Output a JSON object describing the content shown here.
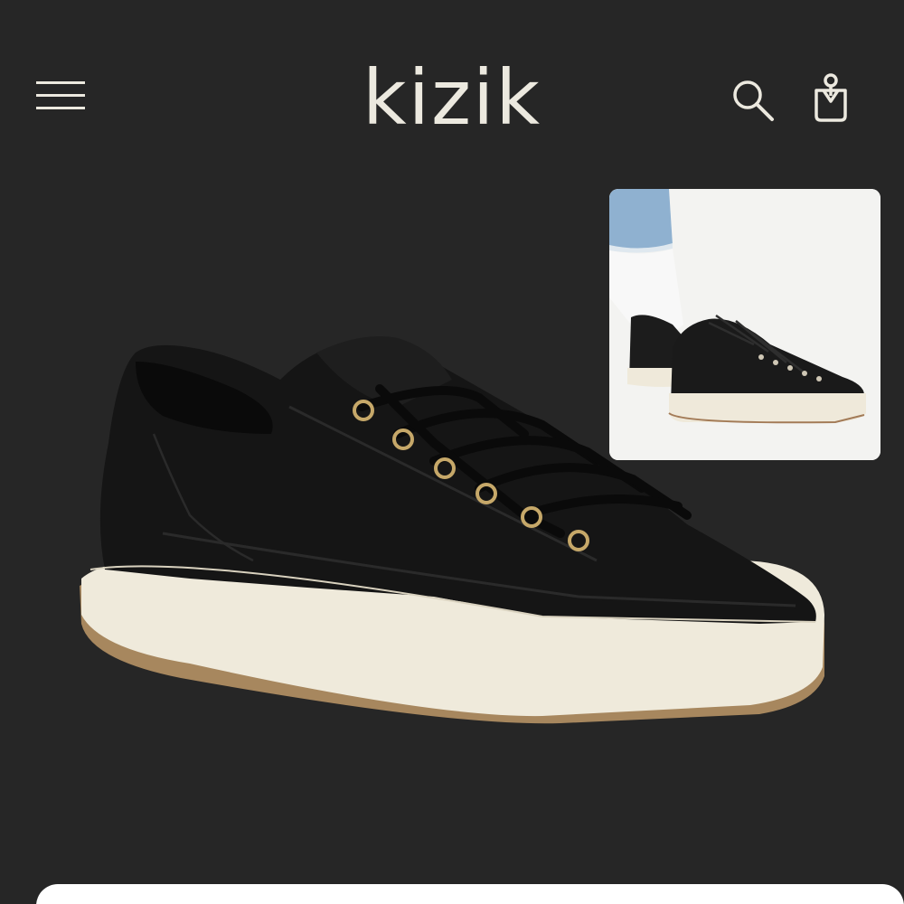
{
  "header": {
    "logo_text": "kizik",
    "menu_icon": "hamburger-menu-icon",
    "search_icon": "search-icon",
    "bag_icon": "shopping-bag-icon"
  },
  "product": {
    "main_image": "black-leather-sneaker",
    "thumbnail_image": "sneaker-on-foot-photo"
  },
  "colors": {
    "background": "#262626",
    "foreground": "#ece9df",
    "shoe": "#141414",
    "sole": "#efeadb",
    "sole_edge": "#a7875e"
  }
}
